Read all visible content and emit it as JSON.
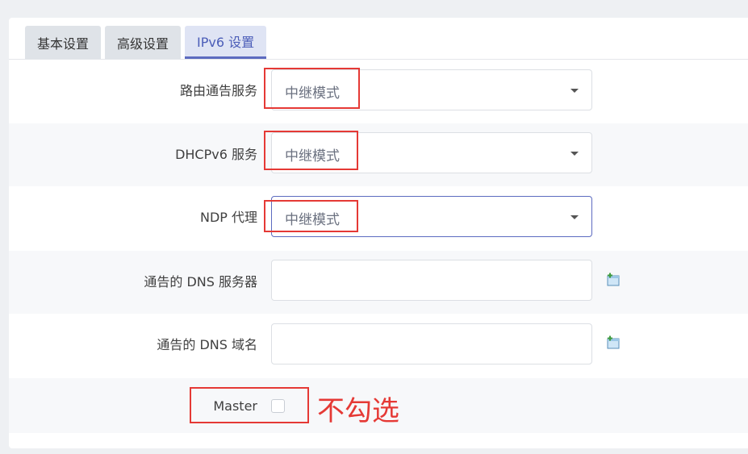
{
  "tabs": [
    {
      "label": "基本设置",
      "active": false
    },
    {
      "label": "高级设置",
      "active": false
    },
    {
      "label": "IPv6 设置",
      "active": true
    }
  ],
  "fields": {
    "ra_service": {
      "label": "路由通告服务",
      "value": "中继模式"
    },
    "dhcpv6_service": {
      "label": "DHCPv6 服务",
      "value": "中继模式"
    },
    "ndp_proxy": {
      "label": "NDP 代理",
      "value": "中继模式"
    },
    "announced_dns_servers": {
      "label": "通告的 DNS 服务器",
      "value": ""
    },
    "announced_dns_domains": {
      "label": "通告的 DNS 域名",
      "value": ""
    },
    "master": {
      "label": "Master",
      "checked": false
    }
  },
  "annotation": {
    "text": "不勾选",
    "color": "#e53935"
  },
  "icons": {
    "add": "add-entry-icon"
  },
  "colors": {
    "accent": "#5c6bc0",
    "highlight": "#e53935"
  }
}
